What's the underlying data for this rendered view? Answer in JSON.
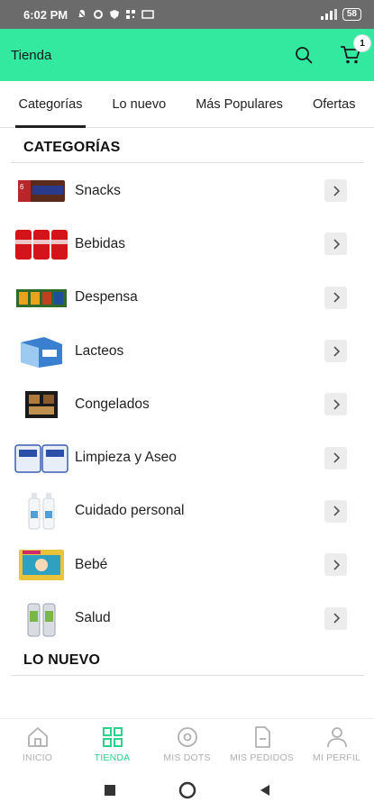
{
  "status_bar": {
    "time": "6:02 PM",
    "battery": "58"
  },
  "app_bar": {
    "title": "Tienda",
    "cart_count": "1"
  },
  "tabs": [
    {
      "label": "Categorías",
      "active": true
    },
    {
      "label": "Lo nuevo",
      "active": false
    },
    {
      "label": "Más Populares",
      "active": false
    },
    {
      "label": "Ofertas",
      "active": false
    }
  ],
  "sections": {
    "categories_title": "CATEGORÍAS",
    "new_title": "LO NUEVO"
  },
  "categories": [
    {
      "label": "Snacks",
      "icon": "snacks-image"
    },
    {
      "label": "Bebidas",
      "icon": "drinks-image"
    },
    {
      "label": "Despensa",
      "icon": "pantry-image"
    },
    {
      "label": "Lacteos",
      "icon": "dairy-image"
    },
    {
      "label": "Congelados",
      "icon": "frozen-image"
    },
    {
      "label": "Limpieza y Aseo",
      "icon": "cleaning-image"
    },
    {
      "label": "Cuidado personal",
      "icon": "personal-care-image"
    },
    {
      "label": "Bebé",
      "icon": "baby-image"
    },
    {
      "label": "Salud",
      "icon": "health-image"
    }
  ],
  "bottom_nav": [
    {
      "label": "INICIO",
      "icon": "home-icon",
      "active": false
    },
    {
      "label": "TIENDA",
      "icon": "grid-icon",
      "active": true
    },
    {
      "label": "MIS DOTS",
      "icon": "dots-icon",
      "active": false
    },
    {
      "label": "MIS PEDIDOS",
      "icon": "orders-icon",
      "active": false
    },
    {
      "label": "MI PERFIL",
      "icon": "profile-icon",
      "active": false
    }
  ],
  "colors": {
    "accent": "#33e9a0",
    "active_nav": "#2ad38c",
    "status_bar": "#6b6b6b"
  }
}
